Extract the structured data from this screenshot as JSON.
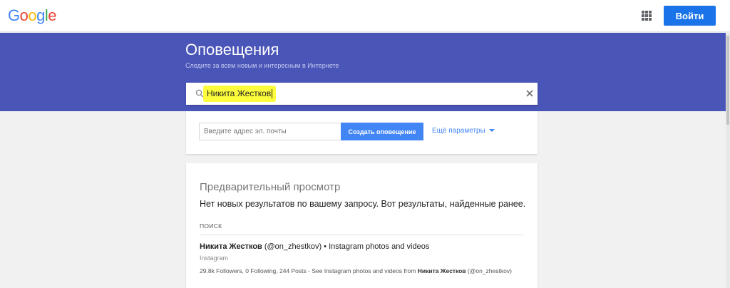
{
  "header": {
    "logo_letters": [
      {
        "char": "G",
        "color": "#4285f4"
      },
      {
        "char": "o",
        "color": "#ea4335"
      },
      {
        "char": "o",
        "color": "#fbbc05"
      },
      {
        "char": "g",
        "color": "#4285f4"
      },
      {
        "char": "l",
        "color": "#34a853"
      },
      {
        "char": "e",
        "color": "#ea4335"
      }
    ],
    "apps_icon": "apps-grid-icon",
    "signin_label": "Войти",
    "signin_color": "#1a73e8"
  },
  "banner": {
    "title": "Оповещения",
    "subtitle": "Следите за всем новым и интересным в Интернете",
    "color": "#4a55b8"
  },
  "search": {
    "value": "Никита Жестков",
    "highlight_color": "#fdfd3c",
    "search_icon": "search-icon",
    "clear_icon": "close-icon"
  },
  "create": {
    "email_placeholder": "Введите адрес эл. почты",
    "create_label": "Создать оповещение",
    "more_options_label": "Ещё параметры",
    "accent": "#4285f4"
  },
  "preview": {
    "title": "Предварительный просмотр",
    "message": "Нет новых результатов по вашему запросу. Вот результаты, найденные ранее.",
    "section_label": "ПОИСК",
    "results": [
      {
        "title_bold": "Никита Жестков",
        "title_rest": " (@on_zhestkov) • Instagram photos and videos",
        "source": "Instagram",
        "snippet_pre": "29.8k Followers, 0 Following, 244 Posts - See Instagram photos and videos from ",
        "snippet_bold": "Никита Жестков",
        "snippet_post": " (@on_zhestkov)"
      }
    ]
  }
}
